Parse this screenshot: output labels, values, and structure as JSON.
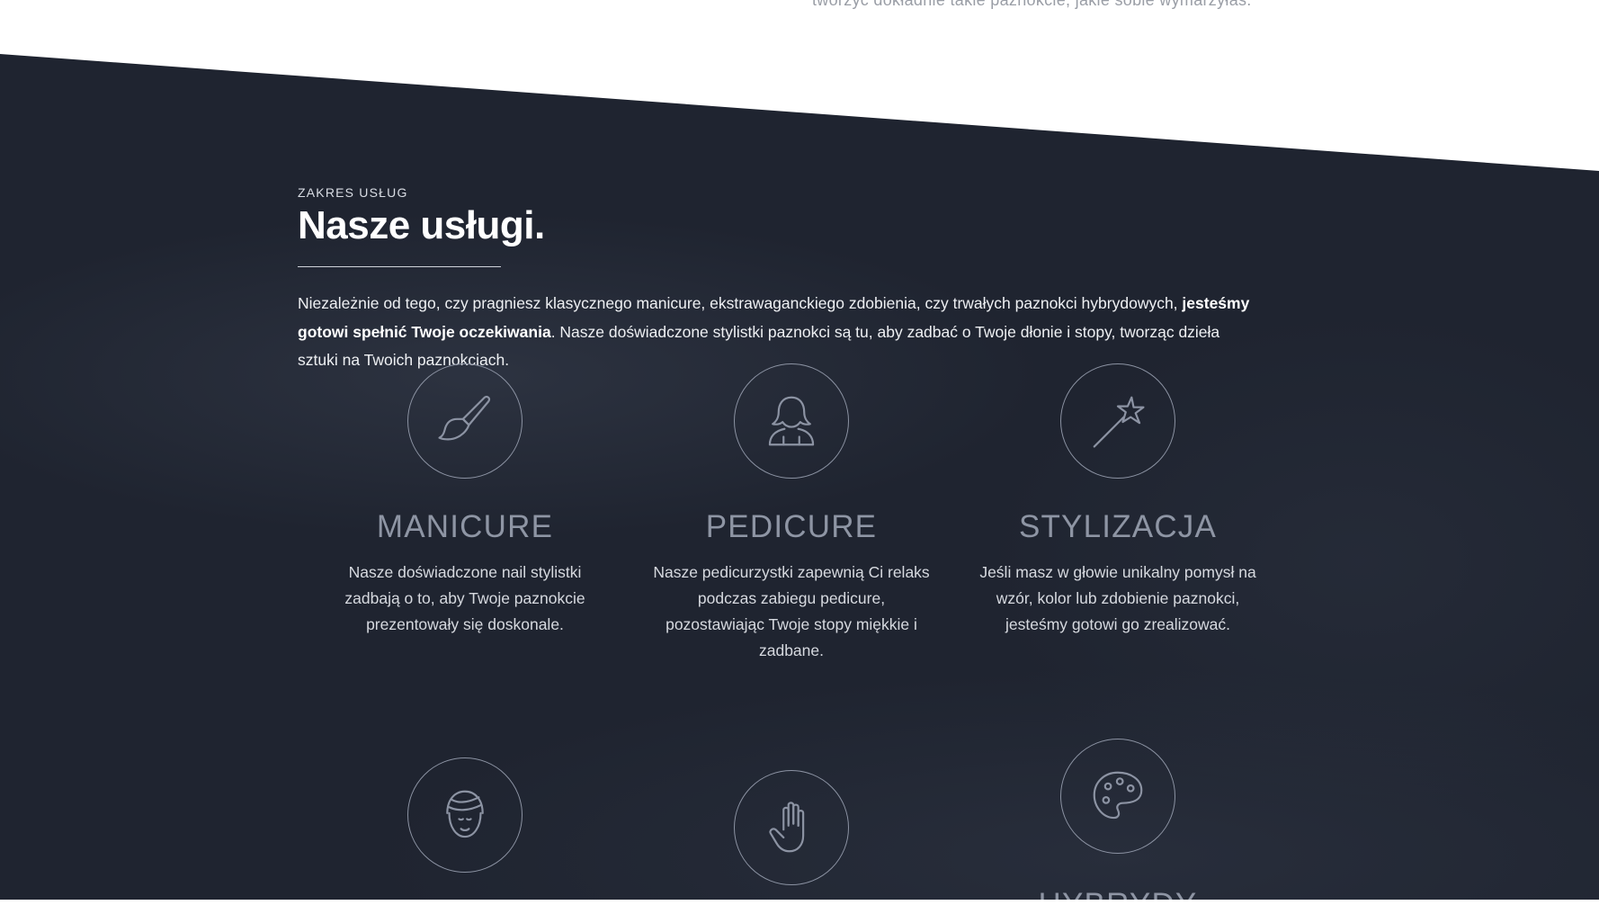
{
  "top_fragment": "tworzyć dokładnie takie paznokcie, jakie sobie wymarzyłaś.",
  "section": {
    "eyebrow": "ZAKRES USŁUG",
    "title": "Nasze usługi.",
    "intro_part1": "Niezależnie od tego, czy pragniesz klasycznego manicure, ekstrawaganckiego zdobienia, czy trwałych paznokci hybrydowych, ",
    "intro_bold": "jesteśmy gotowi spełnić Twoje oczekiwania",
    "intro_part2": ". Nasze doświadczone stylistki paznokci są tu, aby zadbać o Twoje dłonie i stopy, tworząc dzieła sztuki na Twoich paznokciach."
  },
  "services": [
    {
      "name": "MANICURE",
      "description": "Nasze doświadczone nail stylistki zadbają o to, aby Twoje paznokcie prezentowały się doskonale.",
      "icon": "paintbrush-icon"
    },
    {
      "name": "PEDICURE",
      "description": "Nasze pedicurzystki zapewnią Ci relaks podczas zabiegu pedicure, pozostawiając Twoje stopy miękkie i zadbane.",
      "icon": "woman-silhouette-icon"
    },
    {
      "name": "STYLIZACJA",
      "description": "Jeśli masz w głowie unikalny pomysł na wzór, kolor lub zdobienie paznokci, jesteśmy gotowi go zrealizować.",
      "icon": "magic-wand-icon"
    },
    {
      "icon": "spa-face-towel-icon"
    },
    {
      "icon": "hand-icon"
    },
    {
      "name": "HYBRYDY",
      "icon": "palette-icon"
    }
  ],
  "colors": {
    "background_dark": "#1f2430",
    "heading": "#ffffff",
    "service_name": "#8e95a4",
    "icon_stroke": "#8c93a3"
  }
}
